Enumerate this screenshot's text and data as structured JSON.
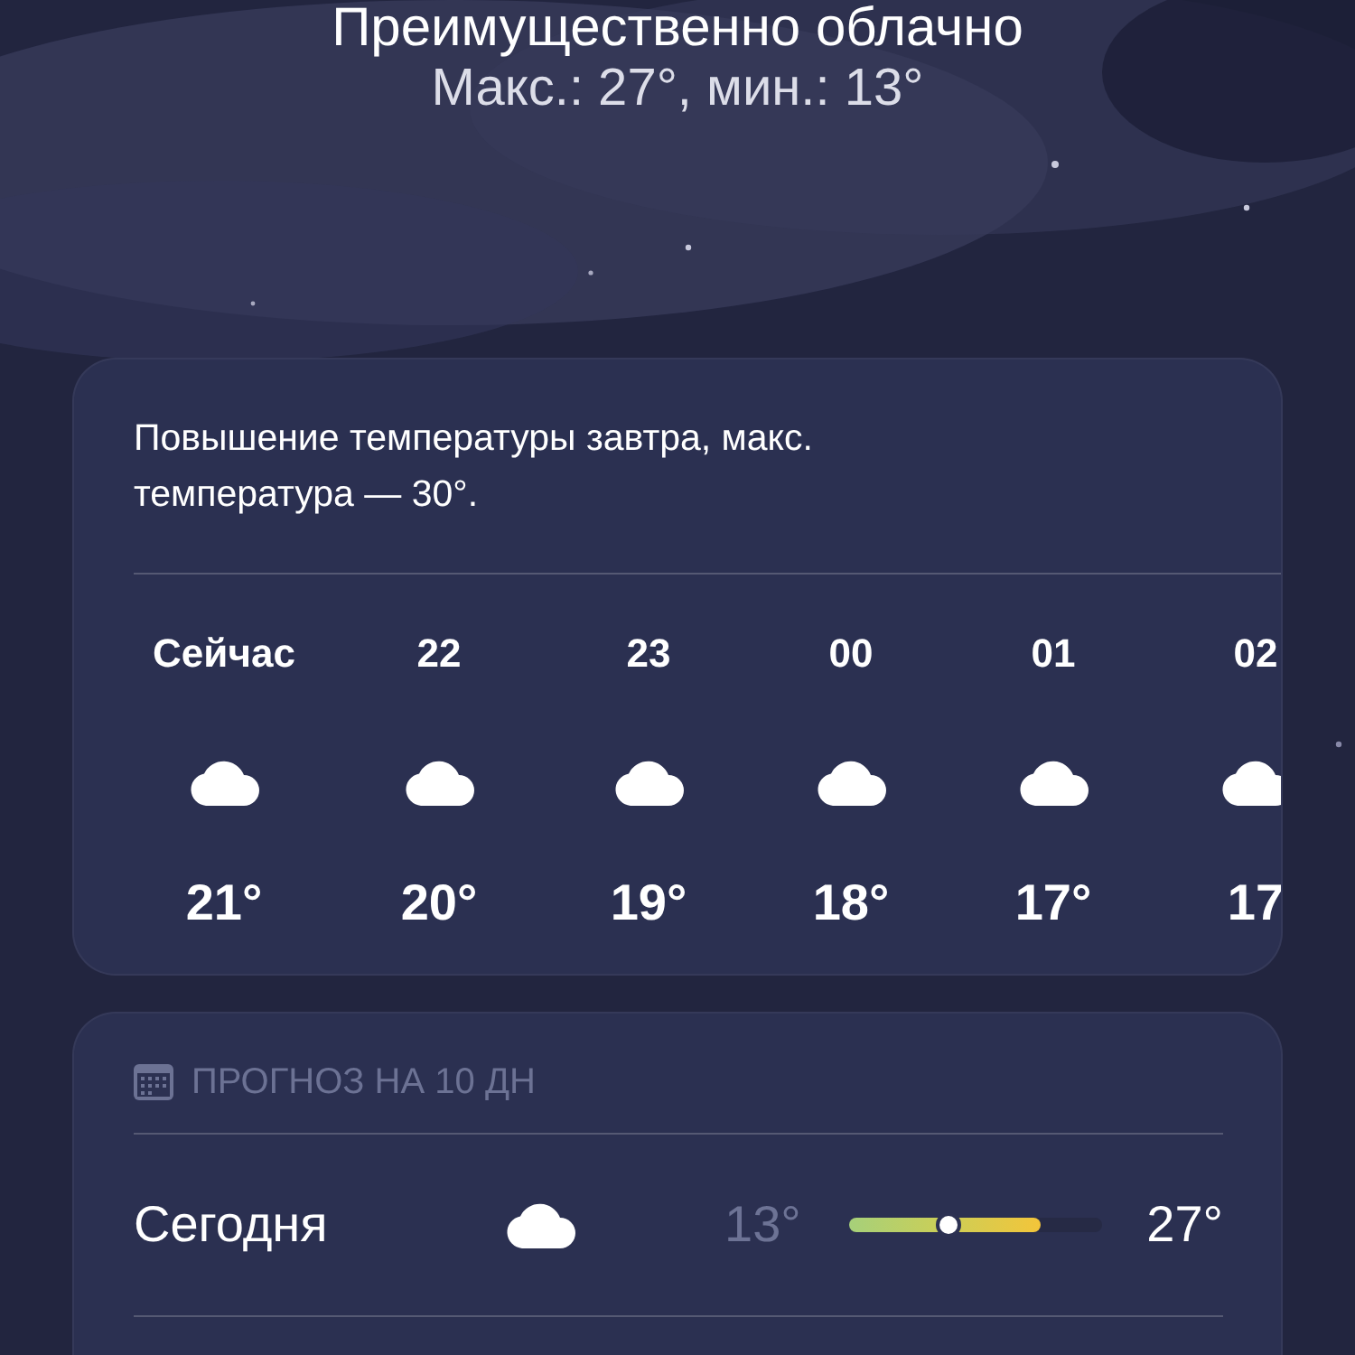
{
  "header": {
    "condition": "Преимущественно облачно",
    "range": "Макс.: 27°, мин.: 13°"
  },
  "hourly": {
    "summary": "Повышение температуры завтра, макс. температура — 30°.",
    "hours": [
      {
        "time": "Сейчас",
        "temp": "21°",
        "kind": "cloud"
      },
      {
        "time": "22",
        "temp": "20°",
        "kind": "cloud"
      },
      {
        "time": "23",
        "temp": "19°",
        "kind": "cloud"
      },
      {
        "time": "00",
        "temp": "18°",
        "kind": "cloud"
      },
      {
        "time": "01",
        "temp": "17°",
        "kind": "cloud"
      },
      {
        "time": "02",
        "temp": "17",
        "kind": "cloud"
      }
    ]
  },
  "daily": {
    "title": "ПРОГНОЗ НА 10 ДН",
    "days": [
      {
        "day": "Сегодня",
        "kind": "cloud",
        "low": "13°",
        "high": "27°",
        "range": {
          "level": 0.76
        },
        "current": {
          "level": 0.39
        }
      }
    ]
  }
}
